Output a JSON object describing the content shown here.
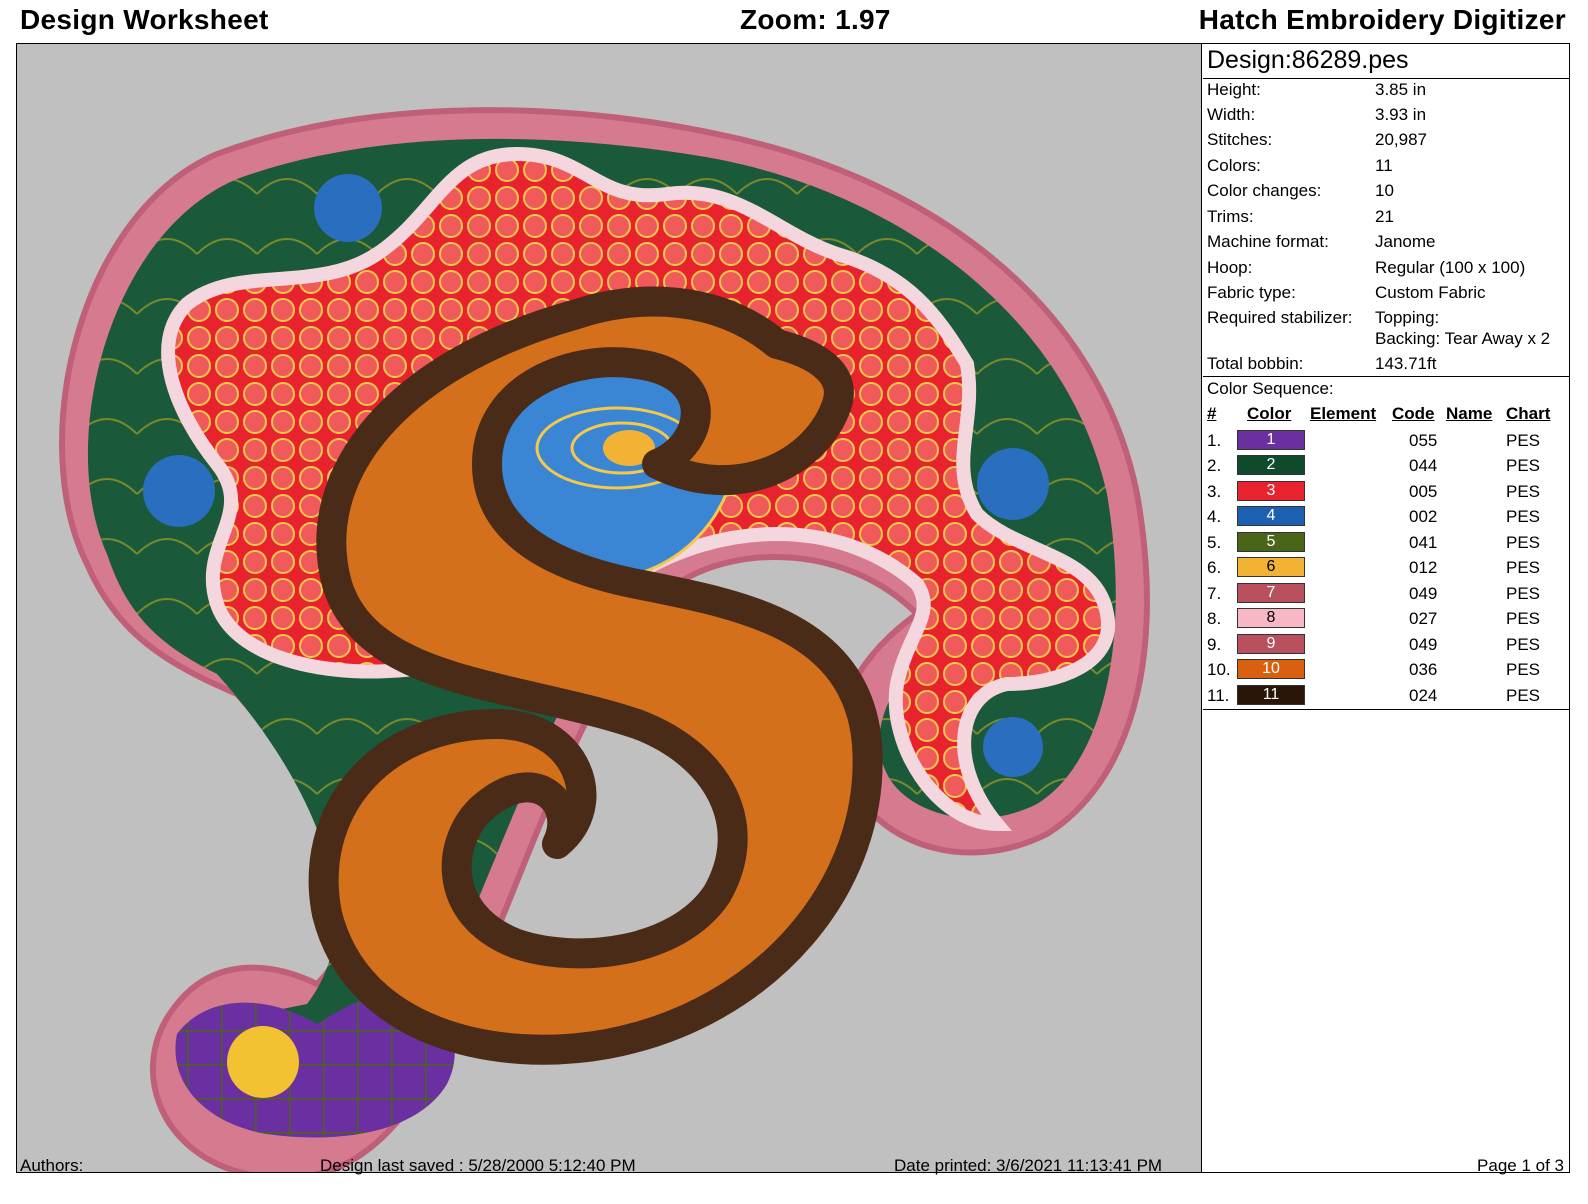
{
  "header": {
    "left": "Design Worksheet",
    "center": "Zoom:  1.97",
    "right": "Hatch Embroidery Digitizer"
  },
  "design": {
    "name": "Design:86289.pes",
    "info": [
      {
        "label": "Height:",
        "value": "3.85 in"
      },
      {
        "label": "Width:",
        "value": "3.93 in"
      },
      {
        "label": "Stitches:",
        "value": "20,987"
      },
      {
        "label": "Colors:",
        "value": "11"
      },
      {
        "label": "Color changes:",
        "value": "10"
      },
      {
        "label": "Trims:",
        "value": "21"
      },
      {
        "label": "Machine format:",
        "value": "Janome"
      },
      {
        "label": "Hoop:",
        "value": "Regular (100 x 100)"
      },
      {
        "label": "Fabric type:",
        "value": "Custom Fabric"
      },
      {
        "label": "Required stabilizer:",
        "value": "Topping:",
        "value2": "Backing: Tear Away x 2"
      },
      {
        "label": "Total bobbin:",
        "value": "143.71ft"
      }
    ]
  },
  "color_sequence": {
    "title": "Color Sequence:",
    "headers": {
      "num": "#",
      "color": "Color",
      "element": "Element",
      "code": "Code",
      "name": "Name",
      "chart": "Chart"
    },
    "rows": [
      {
        "num": "1.",
        "swatch": "1",
        "color": "#6a2fa0",
        "code": "055",
        "chart": "PES"
      },
      {
        "num": "2.",
        "swatch": "2",
        "color": "#0f4a2c",
        "code": "044",
        "chart": "PES"
      },
      {
        "num": "3.",
        "swatch": "3",
        "color": "#e8232d",
        "code": "005",
        "chart": "PES"
      },
      {
        "num": "4.",
        "swatch": "4",
        "color": "#1d5fb0",
        "code": "002",
        "chart": "PES"
      },
      {
        "num": "5.",
        "swatch": "5",
        "color": "#4a6418",
        "code": "041",
        "chart": "PES"
      },
      {
        "num": "6.",
        "swatch": "6",
        "color": "#f2b233",
        "code": "012",
        "chart": "PES"
      },
      {
        "num": "7.",
        "swatch": "7",
        "color": "#b8505e",
        "code": "049",
        "chart": "PES"
      },
      {
        "num": "8.",
        "swatch": "8",
        "color": "#f7b7c4",
        "code": "027",
        "chart": "PES"
      },
      {
        "num": "9.",
        "swatch": "9",
        "color": "#b8505e",
        "code": "049",
        "chart": "PES"
      },
      {
        "num": "10.",
        "swatch": "10",
        "color": "#d8600f",
        "code": "036",
        "chart": "PES"
      },
      {
        "num": "11.",
        "swatch": "11",
        "color": "#2a1608",
        "code": "024",
        "chart": "PES"
      }
    ]
  },
  "footer": {
    "authors": "Authors:",
    "saved": "Design last saved : 5/28/2000 5:12:40 PM",
    "printed": "Date printed: 3/6/2021 11:13:41 PM",
    "page": "Page 1 of 3"
  }
}
